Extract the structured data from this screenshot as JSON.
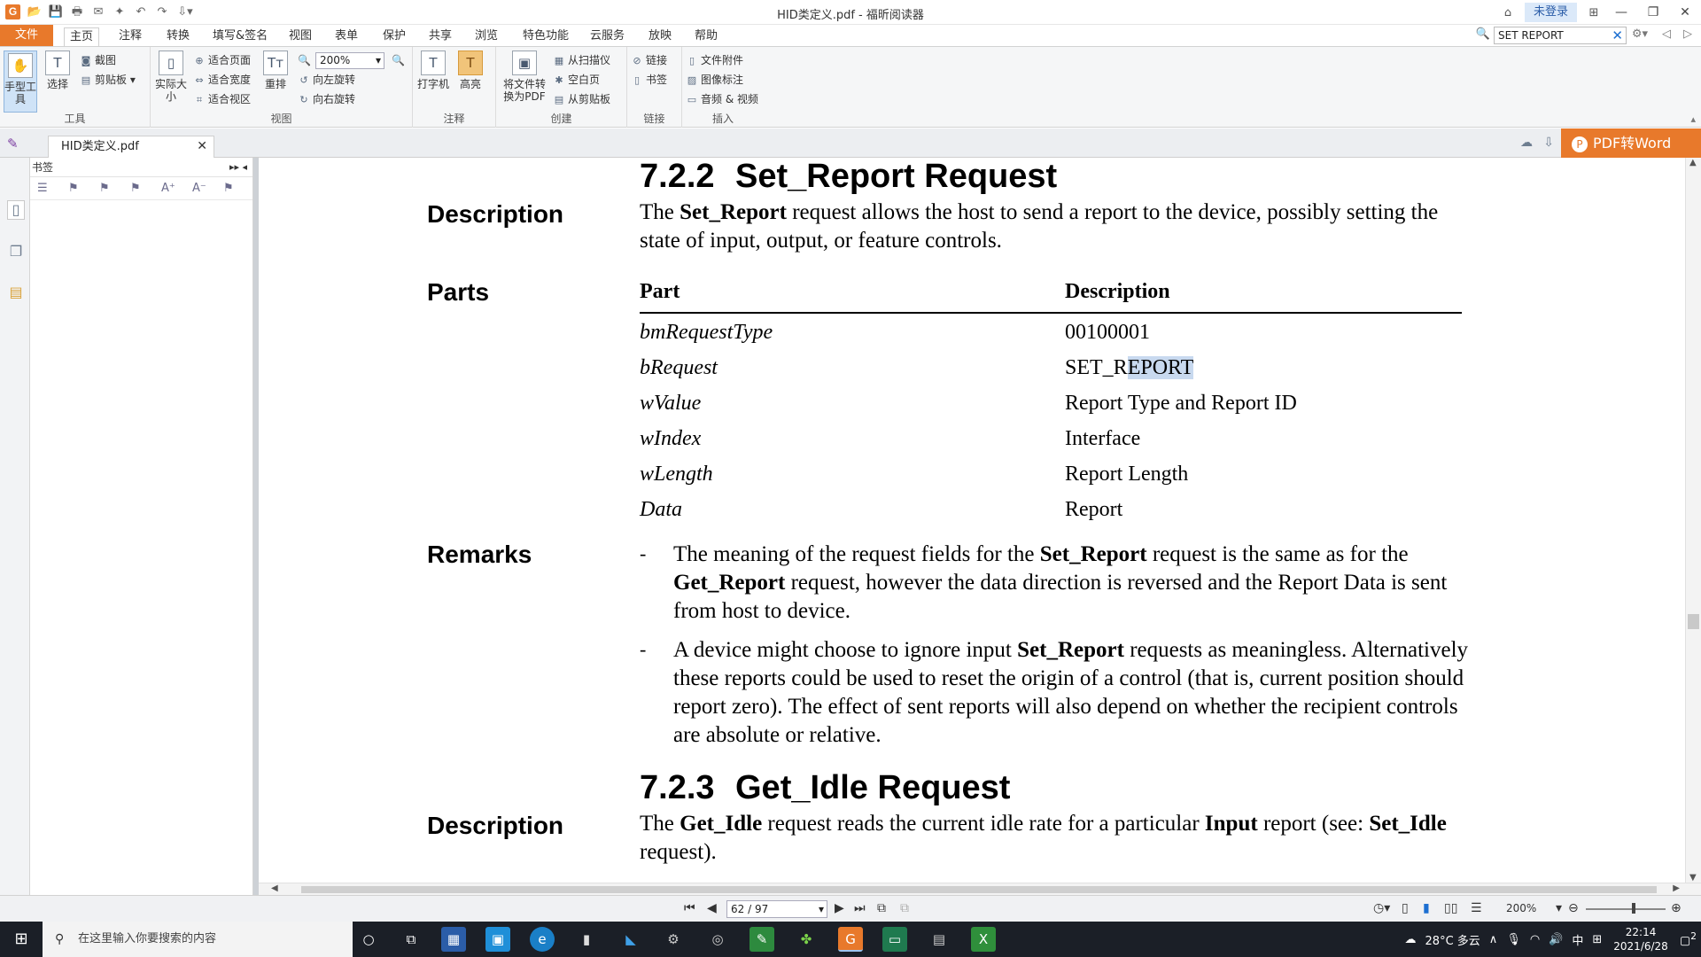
{
  "window": {
    "title": "HID类定义.pdf - 福昕阅读器",
    "login": "未登录"
  },
  "tabs": [
    "文件",
    "主页",
    "注释",
    "转换",
    "填写&签名",
    "视图",
    "表单",
    "保护",
    "共享",
    "浏览",
    "特色功能",
    "云服务",
    "放映",
    "帮助"
  ],
  "search": {
    "value": "SET REPORT"
  },
  "ribbon": {
    "hand": "手型工具",
    "select": "选择",
    "snapshot": "截图",
    "clipboard": "剪贴板",
    "actual_size": "实际大小",
    "fit_page": "适合页面",
    "fit_width": "适合宽度",
    "fit_visible": "适合视区",
    "reflow": "重排",
    "zoom": "200%",
    "rotate_left": "向左旋转",
    "rotate_right": "向右旋转",
    "typewriter": "打字机",
    "highlight": "高亮",
    "convert_pdf": "将文件转换为PDF",
    "from_scanner": "从扫描仪",
    "blank_page": "空白页",
    "from_clipboard": "从剪贴板",
    "link": "链接",
    "bookmark": "书签",
    "file_attachment": "文件附件",
    "image_annotation": "图像标注",
    "audio_video": "音频 & 视频",
    "groups": {
      "tools": "工具",
      "view": "视图",
      "comment": "注释",
      "create": "创建",
      "links": "链接",
      "insert": "插入"
    }
  },
  "doc_tab": {
    "name": "HID类定义.pdf"
  },
  "pdf2word": "PDF转Word",
  "panel": {
    "title": "书签"
  },
  "doc": {
    "h1_num": "7.2.2",
    "h1_title": "Set_Report Request",
    "desc_label": "Description",
    "desc_b": "Set_Report",
    "desc_text_pre": "The ",
    "desc_text_post": " request allows the host to send a report to the device, possibly setting the state of input, output, or feature controls.",
    "parts_label": "Parts",
    "col_part": "Part",
    "col_desc": "Description",
    "rows": [
      {
        "part": "bmRequestType",
        "desc": "00100001"
      },
      {
        "part": "bRequest",
        "desc_a": "SET_R",
        "desc_b": "EPORT"
      },
      {
        "part": "wValue",
        "desc": "Report Type and Report ID"
      },
      {
        "part": "wIndex",
        "desc": "Interface"
      },
      {
        "part": "wLength",
        "desc": "Report Length"
      },
      {
        "part": "Data",
        "desc": "Report"
      }
    ],
    "remarks_label": "Remarks",
    "r1_a": "The meaning of the request fields for the ",
    "r1_b1": "Set_Report",
    "r1_c": " request is the same as for the ",
    "r1_b2": "Get_Report",
    "r1_d": " request, however the data direction is reversed and the Report Data is sent from host to device.",
    "r2_a": "A device might choose to ignore input ",
    "r2_b": "Set_Report",
    "r2_c": " requests as meaningless. Alternatively these reports could be used to reset the origin of a control (that is, current position should report zero). The effect of sent reports will also depend on whether the recipient controls are absolute or relative.",
    "h2_num": "7.2.3",
    "h2_title": "Get_Idle Request",
    "desc2_label": "Description",
    "d2_a": "The ",
    "d2_b1": "Get_Idle",
    "d2_c": " request reads the current idle rate for a particular ",
    "d2_b2": "Input",
    "d2_d": " report (see: ",
    "d2_b3": "Set_Idle",
    "d2_e": " request)."
  },
  "status": {
    "page": "62 / 97",
    "zoom": "200%"
  },
  "taskbar": {
    "search_placeholder": "在这里输入你要搜索的内容",
    "weather": "28°C 多云",
    "ime": "中",
    "time": "22:14",
    "date": "2021/6/28",
    "notif": "2"
  }
}
